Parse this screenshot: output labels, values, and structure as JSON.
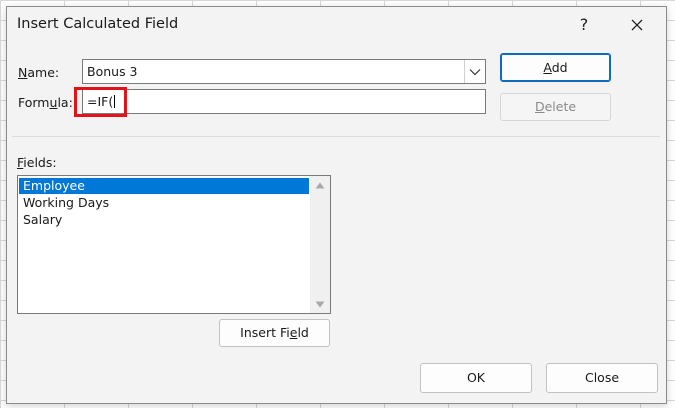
{
  "dialog": {
    "title": "Insert Calculated Field",
    "help_label": "?"
  },
  "name_field": {
    "label_prefix": "",
    "label_mnemonic": "N",
    "label_suffix": "ame:",
    "value": "Bonus 3"
  },
  "formula_field": {
    "label_prefix": "Form",
    "label_mnemonic": "u",
    "label_suffix": "la:",
    "value": "=IF("
  },
  "buttons": {
    "add": {
      "mnemonic": "A",
      "rest": "dd"
    },
    "delete": {
      "prefix": "",
      "mnemonic": "D",
      "rest": "elete"
    },
    "insert_field": {
      "prefix": "Insert Fi",
      "mnemonic": "e",
      "rest": "ld"
    },
    "ok": "OK",
    "close": "Close"
  },
  "fields_list": {
    "label_mnemonic": "F",
    "label_rest": "ields:",
    "items": [
      "Employee",
      "Working Days",
      "Salary"
    ],
    "selected_index": 0
  },
  "colors": {
    "selection": "#0078d7",
    "highlight_box": "#e0141a",
    "default_button_border": "#0f6cbd"
  },
  "icons": {
    "close": "close-icon",
    "dropdown": "chevron-down-icon",
    "scroll_up": "scroll-up-arrow-icon",
    "scroll_down": "scroll-down-arrow-icon"
  }
}
